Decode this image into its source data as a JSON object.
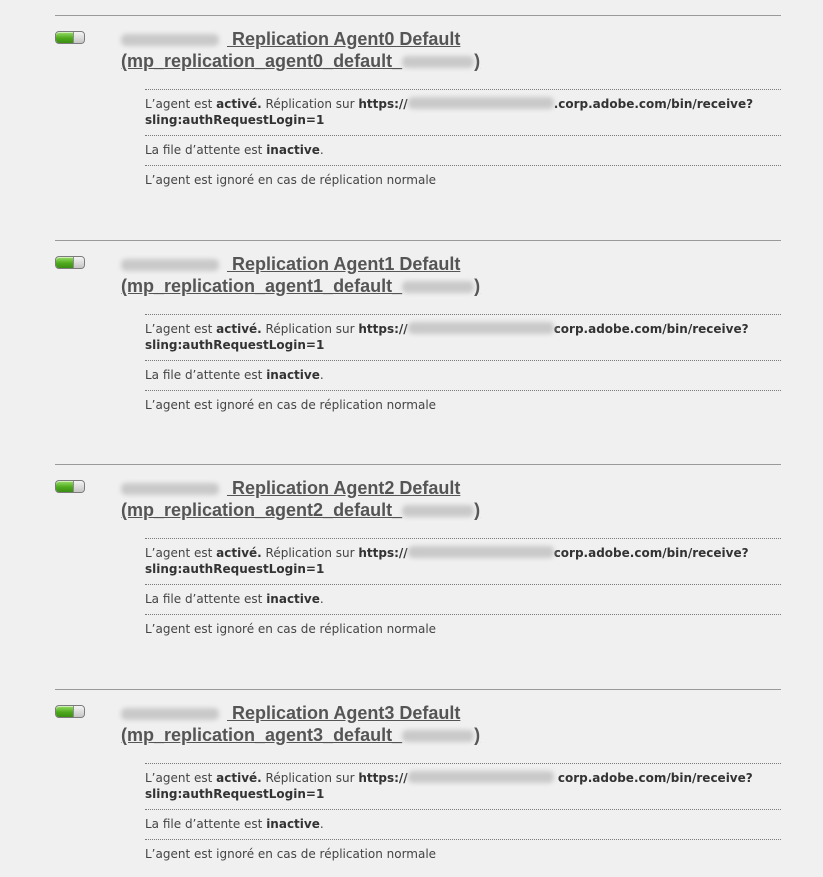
{
  "agents": [
    {
      "title_prefix": " Replication Agent0 Default",
      "title_id_open": "(mp_replication_agent0_default_",
      "title_id_close": ")",
      "status_pre": "L’agent est ",
      "status_state": "activé.",
      "status_mid": " Réplication sur ",
      "url_start": "https://",
      "url_end": ".corp.adobe.com/bin/receive?",
      "url_line2": "sling:authRequestLogin=1",
      "queue_pre": "La file d’attente est ",
      "queue_state": "inactive",
      "queue_end": ".",
      "ignored": "L’agent est ignoré en cas de réplication normale"
    },
    {
      "title_prefix": " Replication Agent1 Default",
      "title_id_open": "(mp_replication_agent1_default_",
      "title_id_close": ")",
      "status_pre": "L’agent est ",
      "status_state": "activé.",
      "status_mid": " Réplication sur ",
      "url_start": "https://",
      "url_end": "corp.adobe.com/bin/receive?",
      "url_line2": "sling:authRequestLogin=1",
      "queue_pre": "La file d’attente est ",
      "queue_state": "inactive",
      "queue_end": ".",
      "ignored": "L’agent est ignoré en cas de réplication normale"
    },
    {
      "title_prefix": " Replication Agent2 Default",
      "title_id_open": "(mp_replication_agent2_default_",
      "title_id_close": ")",
      "status_pre": "L’agent est ",
      "status_state": "activé.",
      "status_mid": " Réplication sur ",
      "url_start": "https://",
      "url_end": "corp.adobe.com/bin/receive?",
      "url_line2": "sling:authRequestLogin=1",
      "queue_pre": "La file d’attente est ",
      "queue_state": "inactive",
      "queue_end": ".",
      "ignored": "L’agent est ignoré en cas de réplication normale"
    },
    {
      "title_prefix": " Replication Agent3 Default",
      "title_id_open": "(mp_replication_agent3_default_",
      "title_id_close": ")",
      "status_pre": "L’agent est ",
      "status_state": "activé.",
      "status_mid": " Réplication sur ",
      "url_start": "https://",
      "url_end": " corp.adobe.com/bin/receive?",
      "url_line2": "sling:authRequestLogin=1",
      "queue_pre": "La file d’attente est ",
      "queue_state": "inactive",
      "queue_end": ".",
      "ignored": "L’agent est ignoré en cas de réplication normale"
    }
  ]
}
